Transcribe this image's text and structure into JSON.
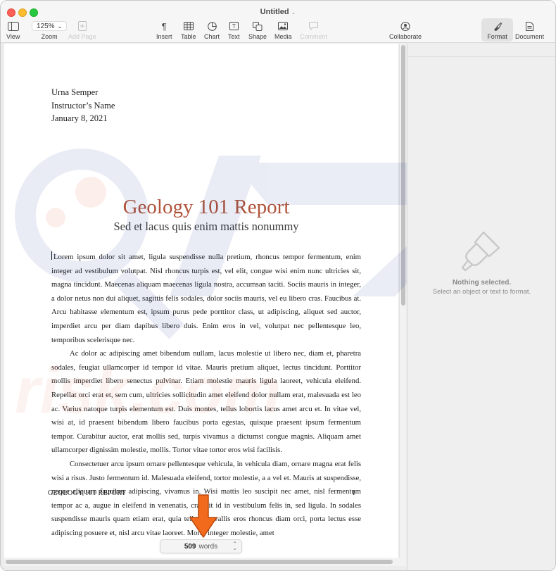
{
  "window": {
    "title": "Untitled"
  },
  "toolbar": {
    "view": "View",
    "zoom_value": "125%",
    "zoom": "Zoom",
    "add_page": "Add Page",
    "insert": "Insert",
    "table": "Table",
    "chart": "Chart",
    "text": "Text",
    "shape": "Shape",
    "media": "Media",
    "comment": "Comment",
    "collaborate": "Collaborate",
    "format": "Format",
    "document": "Document"
  },
  "document": {
    "author": "Urna Semper",
    "instructor": "Instructor’s Name",
    "date": "January 8, 2021",
    "title": "Geology 101 Report",
    "subtitle": "Sed et lacus quis enim mattis nonummy",
    "paragraphs": [
      "Lorem ipsum dolor sit amet, ligula suspendisse nulla pretium, rhoncus tempor fermentum, enim integer ad vestibulum volutpat. Nisl rhoncus turpis est, vel elit, congue wisi enim nunc ultricies sit, magna tincidunt. Maecenas aliquam maecenas ligula nostra, accumsan taciti. Sociis mauris in integer, a dolor netus non dui aliquet, sagittis felis sodales, dolor sociis mauris, vel eu libero cras. Faucibus at. Arcu habitasse elementum est, ipsum purus pede porttitor class, ut adipiscing, aliquet sed auctor, imperdiet arcu per diam dapibus libero duis. Enim eros in vel, volutpat nec pellentesque leo, temporibus scelerisque nec.",
      "Ac dolor ac adipiscing amet bibendum nullam, lacus molestie ut libero nec, diam et, pharetra sodales, feugiat ullamcorper id tempor id vitae. Mauris pretium aliquet, lectus tincidunt. Porttitor mollis imperdiet libero senectus pulvinar. Etiam molestie mauris ligula laoreet, vehicula eleifend. Repellat orci erat et, sem cum, ultricies sollicitudin amet eleifend dolor nullam erat, malesuada est leo ac. Varius natoque turpis elementum est. Duis montes, tellus lobortis lacus amet arcu et. In vitae vel, wisi at, id praesent bibendum libero faucibus porta egestas, quisque praesent ipsum fermentum tempor. Curabitur auctor, erat mollis sed, turpis vivamus a dictumst congue magnis. Aliquam amet ullamcorper dignissim molestie, mollis. Tortor vitae tortor eros wisi facilisis.",
      "Consectetuer arcu ipsum ornare pellentesque vehicula, in vehicula diam, ornare magna erat felis wisi a risus. Justo fermentum id. Malesuada eleifend, tortor molestie, a a vel et. Mauris at suspendisse, neque aliquam faucibus adipiscing, vivamus in. Wisi mattis leo suscipit nec amet, nisl fermentum tempor ac a, augue in eleifend in venenatis, cras sit id in vestibulum felis in, sed ligula. In sodales suspendisse mauris quam etiam erat, quia tellus convallis eros rhoncus diam orci, porta lectus esse adipiscing posuere et, nisl arcu vitae laoreet. Morbi integer molestie, amet"
    ],
    "footer_left": "GEOLOGY 101 REPORT",
    "footer_right": "1"
  },
  "word_count": {
    "number": "509",
    "unit": "words"
  },
  "inspector": {
    "title": "Nothing selected.",
    "subtitle": "Select an object or text to format."
  },
  "colors": {
    "title_accent": "#b0533a",
    "arrow": "#f26a1b"
  },
  "icons": [
    "sidebar-icon",
    "add-page-icon",
    "pilcrow-icon",
    "table-icon",
    "chart-icon",
    "text-box-icon",
    "shape-icon",
    "media-icon",
    "comment-icon",
    "collaborate-icon",
    "paintbrush-icon",
    "document-icon"
  ]
}
